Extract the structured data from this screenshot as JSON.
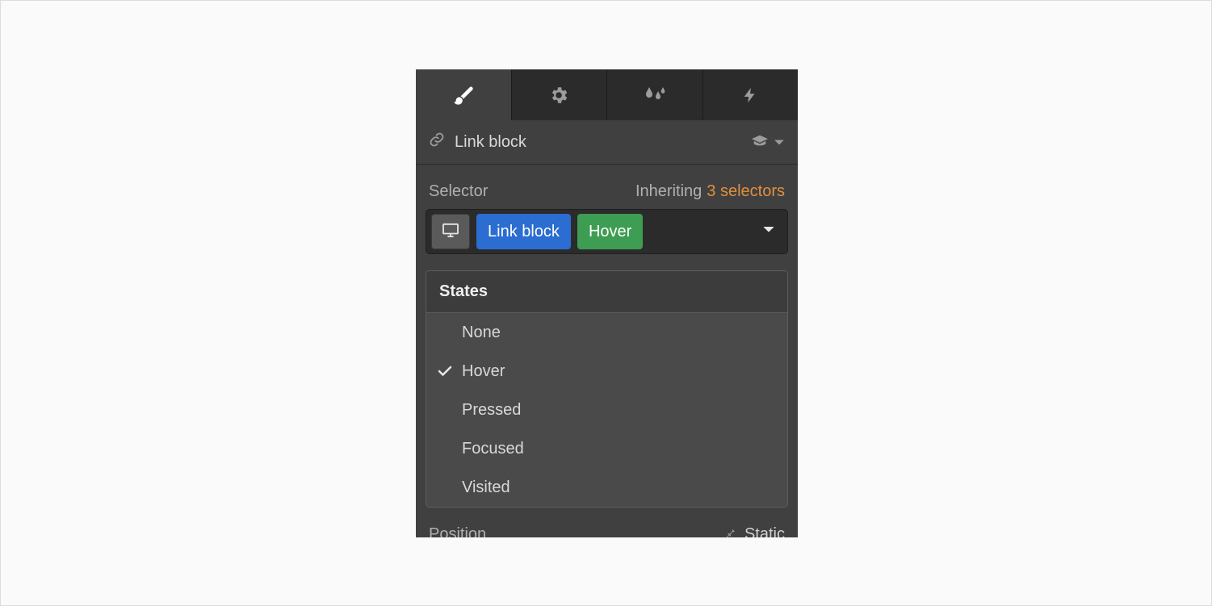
{
  "header": {
    "element_label": "Link block"
  },
  "selector": {
    "label": "Selector",
    "inheriting_label": "Inheriting",
    "inheriting_count": "3 selectors",
    "chips": {
      "class": "Link block",
      "state": "Hover"
    }
  },
  "states": {
    "header": "States",
    "items": [
      "None",
      "Hover",
      "Pressed",
      "Focused",
      "Visited"
    ],
    "selected": "Hover"
  },
  "position": {
    "label": "Position",
    "value": "Static"
  }
}
